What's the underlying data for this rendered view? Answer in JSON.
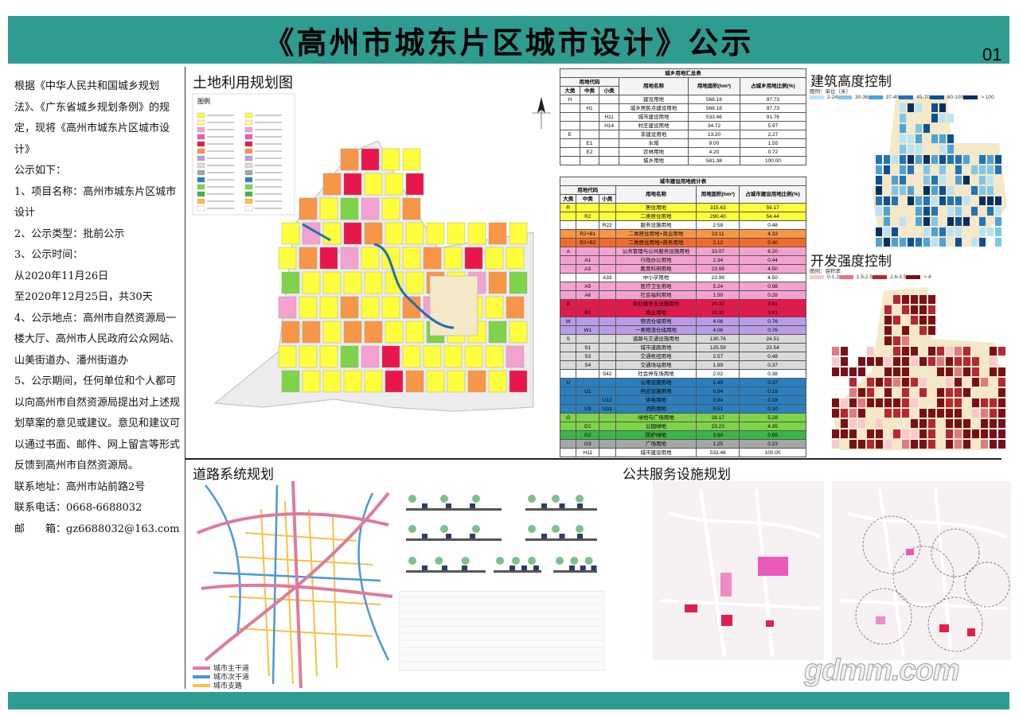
{
  "header": {
    "title": "《高州市城东片区城市设计》公示",
    "page_number": "01"
  },
  "notice": {
    "text": "根据《中华人民共和国城乡规划法》、《广东省城乡规划条例》的规定，现将《高州市城东片区城市设计》\n公示如下：\n1、项目名称：高州市城东片区城市设计\n2、公示类型：批前公示\n3、公示时间：\n从2020年11月26日\n至2020年12月25日，共30天\n4、公示地点：高州市自然资源局一楼大厅、高州市人民政府公众网站、山美街道办、潘州街道办\n5、公示期间，任何单位和个人都可以向高州市自然资源局提出对上述规划草案的意见或建议。意见和建议可以通过书面、邮件、网上留言等形式反馈到高州市自然资源局。\n联系地址：高州市站前路2号\n联系电话：0668-6688032\n邮　　箱：gz6688032@163.com"
  },
  "sections": {
    "land_use": "土地利用规划图",
    "legend": "图例",
    "height": "建筑高度控制",
    "intensity": "开发强度控制",
    "road": "道路系统规划",
    "public": "公共服务设施规划"
  },
  "table1": {
    "title": "城乡用地汇总表",
    "h_code": "用地代码",
    "h_big": "大类",
    "h_mid": "中类",
    "h_small": "小类",
    "h_name": "用地名称",
    "h_area": "用地面积(hm²)",
    "h_ratio": "占城乡用地比例(%)",
    "rows": [
      {
        "big": "H",
        "mid": "",
        "small": "",
        "name": "建设用地",
        "area": "568.18",
        "ratio": "97.73"
      },
      {
        "big": "",
        "mid": "H1",
        "small": "",
        "name": "城乡居民点建设用地",
        "area": "568.18",
        "ratio": "97.73"
      },
      {
        "big": "",
        "mid": "",
        "small": "H11",
        "name": "城市建设用地",
        "area": "533.46",
        "ratio": "91.76"
      },
      {
        "big": "",
        "mid": "",
        "small": "H14",
        "name": "村庄建设用地",
        "area": "34.72",
        "ratio": "5.97"
      },
      {
        "big": "E",
        "mid": "",
        "small": "",
        "name": "非建设用地",
        "area": "13.20",
        "ratio": "2.27"
      },
      {
        "big": "",
        "mid": "E1",
        "small": "",
        "name": "水域",
        "area": "9.00",
        "ratio": "1.55"
      },
      {
        "big": "",
        "mid": "E2",
        "small": "",
        "name": "农林用地",
        "area": "4.20",
        "ratio": "0.72"
      },
      {
        "big": "",
        "mid": "",
        "small": "",
        "name": "城乡用地",
        "area": "581.38",
        "ratio": "100.00"
      }
    ]
  },
  "table2": {
    "title": "城市建设用地统计表",
    "h_ratio": "占城市建设用地比例(%)",
    "rows": [
      {
        "big": "R",
        "mid": "",
        "small": "",
        "name": "居住用地",
        "area": "315.63",
        "ratio": "59.17",
        "color": "#ffff3c"
      },
      {
        "big": "",
        "mid": "R2",
        "small": "",
        "name": "二类居住用地",
        "area": "290.40",
        "ratio": "54.44",
        "color": "#ffff3c"
      },
      {
        "big": "",
        "mid": "",
        "small": "R22",
        "name": "服务设施用地",
        "area": "2.58",
        "ratio": "0.48",
        "color": "#ffffff"
      },
      {
        "big": "",
        "mid": "R2+B1",
        "small": "",
        "name": "二类居住用地+商业用地",
        "area": "23.11",
        "ratio": "4.33",
        "color": "#f79646"
      },
      {
        "big": "",
        "mid": "R2+B2",
        "small": "",
        "name": "二类居住用地+商务用地",
        "area": "2.12",
        "ratio": "0.40",
        "color": "#f06c2a"
      },
      {
        "big": "A",
        "mid": "",
        "small": "",
        "name": "公共管理与公共服务设施用地",
        "area": "33.07",
        "ratio": "6.20",
        "color": "#f3a2d0"
      },
      {
        "big": "",
        "mid": "A1",
        "small": "",
        "name": "行政办公用地",
        "area": "2.34",
        "ratio": "0.44",
        "color": "#f3a2d0"
      },
      {
        "big": "",
        "mid": "A3",
        "small": "",
        "name": "教育科研用地",
        "area": "23.99",
        "ratio": "4.50",
        "color": "#f3a2d0"
      },
      {
        "big": "",
        "mid": "",
        "small": "A33",
        "name": "中小学用地",
        "area": "23.99",
        "ratio": "4.50",
        "color": "#ffffff"
      },
      {
        "big": "",
        "mid": "A5",
        "small": "",
        "name": "医疗卫生用地",
        "area": "5.24",
        "ratio": "0.98",
        "color": "#f3a2d0"
      },
      {
        "big": "",
        "mid": "A6",
        "small": "",
        "name": "社会福利用地",
        "area": "1.50",
        "ratio": "0.28",
        "color": "#f3a2d0"
      },
      {
        "big": "B",
        "mid": "",
        "small": "",
        "name": "商业服务业设施用地",
        "area": "20.32",
        "ratio": "3.81",
        "color": "#e8174b"
      },
      {
        "big": "",
        "mid": "B1",
        "small": "",
        "name": "商业用地",
        "area": "20.32",
        "ratio": "3.81",
        "color": "#e8174b"
      },
      {
        "big": "W",
        "mid": "",
        "small": "",
        "name": "物流仓储用地",
        "area": "4.06",
        "ratio": "0.76",
        "color": "#b99be6"
      },
      {
        "big": "",
        "mid": "W1",
        "small": "",
        "name": "一类物流仓储用地",
        "area": "4.06",
        "ratio": "0.76",
        "color": "#b99be6"
      },
      {
        "big": "S",
        "mid": "",
        "small": "",
        "name": "道路与交通设施用地",
        "area": "130.76",
        "ratio": "24.51",
        "color": "#d9d9d9"
      },
      {
        "big": "",
        "mid": "S1",
        "small": "",
        "name": "城市道路用地",
        "area": "125.59",
        "ratio": "23.54",
        "color": "#d9d9d9"
      },
      {
        "big": "",
        "mid": "S3",
        "small": "",
        "name": "交通枢纽用地",
        "area": "2.57",
        "ratio": "0.48",
        "color": "#d9d9d9"
      },
      {
        "big": "",
        "mid": "S4",
        "small": "",
        "name": "交通场站用地",
        "area": "1.99",
        "ratio": "0.37",
        "color": "#d9d9d9"
      },
      {
        "big": "",
        "mid": "",
        "small": "S42",
        "name": "社会停车场用地",
        "area": "2.02",
        "ratio": "0.38",
        "color": "#ffffff"
      },
      {
        "big": "U",
        "mid": "",
        "small": "",
        "name": "公用设施用地",
        "area": "1.45",
        "ratio": "0.27",
        "color": "#2a7fbf"
      },
      {
        "big": "",
        "mid": "U1",
        "small": "",
        "name": "供应设施用地",
        "area": "0.94",
        "ratio": "0.18",
        "color": "#2a7fbf"
      },
      {
        "big": "",
        "mid": "",
        "small": "U12",
        "name": "供电用地",
        "area": "0.94",
        "ratio": "0.18",
        "color": "#2a7fbf"
      },
      {
        "big": "",
        "mid": "U3",
        "small": "U31",
        "name": "消防用地",
        "area": "0.51",
        "ratio": "0.10",
        "color": "#2a7fbf"
      },
      {
        "big": "G",
        "mid": "",
        "small": "",
        "name": "绿地与广场用地",
        "area": "28.17",
        "ratio": "5.28",
        "color": "#7ed348"
      },
      {
        "big": "",
        "mid": "G1",
        "small": "",
        "name": "公园绿地",
        "area": "23.23",
        "ratio": "4.35",
        "color": "#7ed348"
      },
      {
        "big": "",
        "mid": "G2",
        "small": "",
        "name": "防护绿地",
        "area": "3.69",
        "ratio": "0.69",
        "color": "#3bb54a"
      },
      {
        "big": "",
        "mid": "G3",
        "small": "",
        "name": "广场用地",
        "area": "1.25",
        "ratio": "0.23",
        "color": "#a6a6a6"
      },
      {
        "big": "",
        "mid": "H11",
        "small": "",
        "name": "城市建设用地",
        "area": "533.46",
        "ratio": "100.00",
        "color": "#ffffff"
      }
    ]
  },
  "height_legend": {
    "unit": "图例：单位（米）",
    "items": [
      {
        "label": "2-24",
        "color": "#b8e3f5"
      },
      {
        "label": "30-36",
        "color": "#7fc6ea"
      },
      {
        "label": "37-40",
        "color": "#4aa3d9"
      },
      {
        "label": "45-70",
        "color": "#1f74bb"
      },
      {
        "label": "80-100",
        "color": "#0d4f95"
      },
      {
        "label": "> 100",
        "color": "#062f66"
      }
    ]
  },
  "intensity_legend": {
    "unit": "图例：容积率",
    "items": [
      {
        "label": "0-1.2",
        "color": "#f7c9cf"
      },
      {
        "label": "1.5-2.5",
        "color": "#e07a83"
      },
      {
        "label": "2.6-3.5",
        "color": "#b72632"
      },
      {
        "label": "> 4",
        "color": "#7a0f18"
      }
    ]
  },
  "road_legend": [
    {
      "label": "城市主干道",
      "color": "#e07a9a"
    },
    {
      "label": "城市次干道",
      "color": "#4a97d9"
    },
    {
      "label": "城市支路",
      "color": "#f5c242"
    }
  ],
  "watermark": "gdmm.com"
}
